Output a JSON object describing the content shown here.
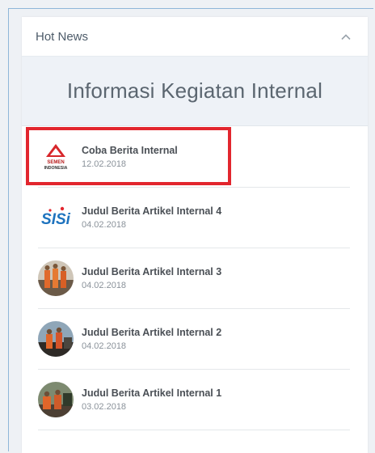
{
  "panel": {
    "title": "Hot News",
    "section_title": "Informasi Kegiatan Internal"
  },
  "news": [
    {
      "title": "Coba Berita Internal",
      "date": "12.02.2018",
      "thumb": "semen-indonesia-logo"
    },
    {
      "title": "Judul Berita Artikel Internal 4",
      "date": "04.02.2018",
      "thumb": "sisi-logo"
    },
    {
      "title": "Judul Berita Artikel Internal 3",
      "date": "04.02.2018",
      "thumb": "photo-workers"
    },
    {
      "title": "Judul Berita Artikel Internal 2",
      "date": "04.02.2018",
      "thumb": "photo-workers"
    },
    {
      "title": "Judul Berita Artikel Internal 1",
      "date": "03.02.2018",
      "thumb": "photo-workers"
    }
  ],
  "logos": {
    "semen_line1": "SEMEN",
    "semen_line2": "INDONESIA",
    "sisi": "SISi"
  },
  "colors": {
    "highlight": "#e2262e",
    "logo_red": "#d7262b",
    "sisi_blue": "#1e73be"
  }
}
